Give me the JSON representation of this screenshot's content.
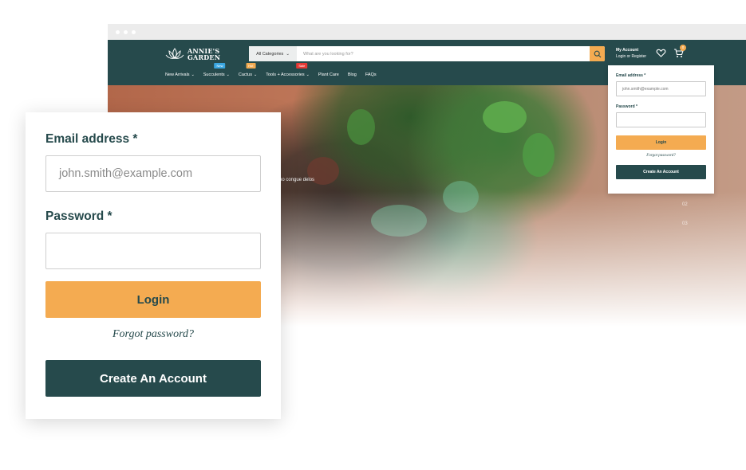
{
  "colors": {
    "brand": "#264a4c",
    "accent": "#f4ab51",
    "new_badge": "#3aa6e0",
    "hot_badge": "#f4ab51",
    "sale_badge": "#e53935"
  },
  "site": {
    "logo": {
      "line1": "ANNIE'S",
      "line2": "GARDEN",
      "icon": "lotus-icon"
    },
    "search": {
      "category": "All Categories",
      "placeholder": "What are you looking for?",
      "icon": "search-icon"
    },
    "account": {
      "title": "My Account",
      "subtitle": "Login or Register"
    },
    "wishlist_icon": "heart-icon",
    "cart": {
      "icon": "cart-icon",
      "count": "0"
    },
    "nav": [
      {
        "label": "New Arrivals",
        "chevron": true,
        "badge": ""
      },
      {
        "label": "Succulents",
        "chevron": true,
        "badge": "New"
      },
      {
        "label": "Cactus",
        "chevron": true,
        "badge": "Hot"
      },
      {
        "label": "Tools + Accessories",
        "chevron": true,
        "badge": "Sale"
      },
      {
        "label": "Plant Care",
        "chevron": false,
        "badge": ""
      },
      {
        "label": "Blog",
        "chevron": false,
        "badge": ""
      },
      {
        "label": "FAQs",
        "chevron": false,
        "badge": ""
      }
    ],
    "hero": {
      "text": "no congue delos",
      "slides": [
        "02",
        "03"
      ]
    }
  },
  "mini_login": {
    "email_label": "Email address *",
    "email_value": "john.smith@example.com",
    "password_label": "Password *",
    "login_label": "Login",
    "forgot_label": "Forgot password?",
    "create_label": "Create An Account"
  },
  "login": {
    "email_label": "Email address *",
    "email_value": "john.smith@example.com",
    "password_label": "Password *",
    "password_value": "",
    "login_label": "Login",
    "forgot_label": "Forgot password?",
    "create_label": "Create An Account"
  }
}
